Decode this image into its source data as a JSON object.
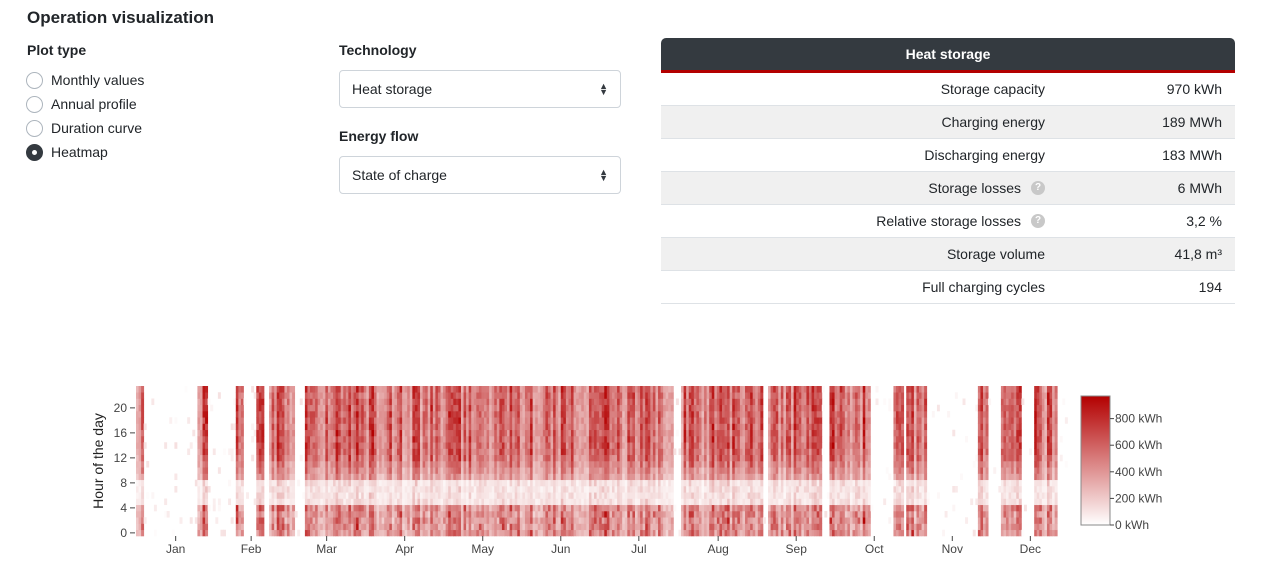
{
  "page": {
    "title": "Operation visualization"
  },
  "plot_type": {
    "label": "Plot type",
    "options": [
      {
        "label": "Monthly values",
        "checked": false
      },
      {
        "label": "Annual profile",
        "checked": false
      },
      {
        "label": "Duration curve",
        "checked": false
      },
      {
        "label": "Heatmap",
        "checked": true
      }
    ]
  },
  "technology": {
    "label": "Technology",
    "value": "Heat storage"
  },
  "energy_flow": {
    "label": "Energy flow",
    "value": "State of charge"
  },
  "table": {
    "title": "Heat storage",
    "rows": [
      {
        "label": "Storage capacity",
        "value": "970 kWh",
        "help": false
      },
      {
        "label": "Charging energy",
        "value": "189 MWh",
        "help": false
      },
      {
        "label": "Discharging energy",
        "value": "183 MWh",
        "help": false
      },
      {
        "label": "Storage losses",
        "value": "6 MWh",
        "help": true
      },
      {
        "label": "Relative storage losses",
        "value": "3,2 %",
        "help": true
      },
      {
        "label": "Storage volume",
        "value": "41,8 m³",
        "help": false
      },
      {
        "label": "Full charging cycles",
        "value": "194",
        "help": false
      }
    ]
  },
  "chart_data": {
    "type": "heatmap",
    "ylabel": "Hour of the day",
    "yticks": [
      0,
      4,
      8,
      12,
      16,
      20
    ],
    "ytick_labels": [
      "0",
      "4",
      "8",
      "12",
      "16",
      "20"
    ],
    "ylim": [
      0,
      23
    ],
    "months": [
      "Jan",
      "Feb",
      "Mar",
      "Apr",
      "May",
      "Jun",
      "Jul",
      "Aug",
      "Sep",
      "Oct",
      "Nov",
      "Dec"
    ],
    "colorbar": {
      "min": 0,
      "max": 970,
      "ticks": [
        0,
        200,
        400,
        600,
        800
      ],
      "tick_labels": [
        "0 kWh",
        "200 kWh",
        "400 kWh",
        "600 kWh",
        "800 kWh"
      ],
      "color_low": "#ffffff",
      "color_high": "#b30000"
    },
    "active_periods_day_of_year": [
      [
        1,
        3
      ],
      [
        25,
        28
      ],
      [
        40,
        42
      ],
      [
        48,
        50
      ],
      [
        53,
        62
      ],
      [
        67,
        210
      ],
      [
        214,
        245
      ],
      [
        248,
        268
      ],
      [
        272,
        287
      ],
      [
        297,
        300
      ],
      [
        302,
        309
      ],
      [
        330,
        333
      ],
      [
        339,
        346
      ],
      [
        352,
        360
      ]
    ]
  },
  "colors": {
    "accent": "#b30000",
    "header_bg": "#343a40"
  }
}
